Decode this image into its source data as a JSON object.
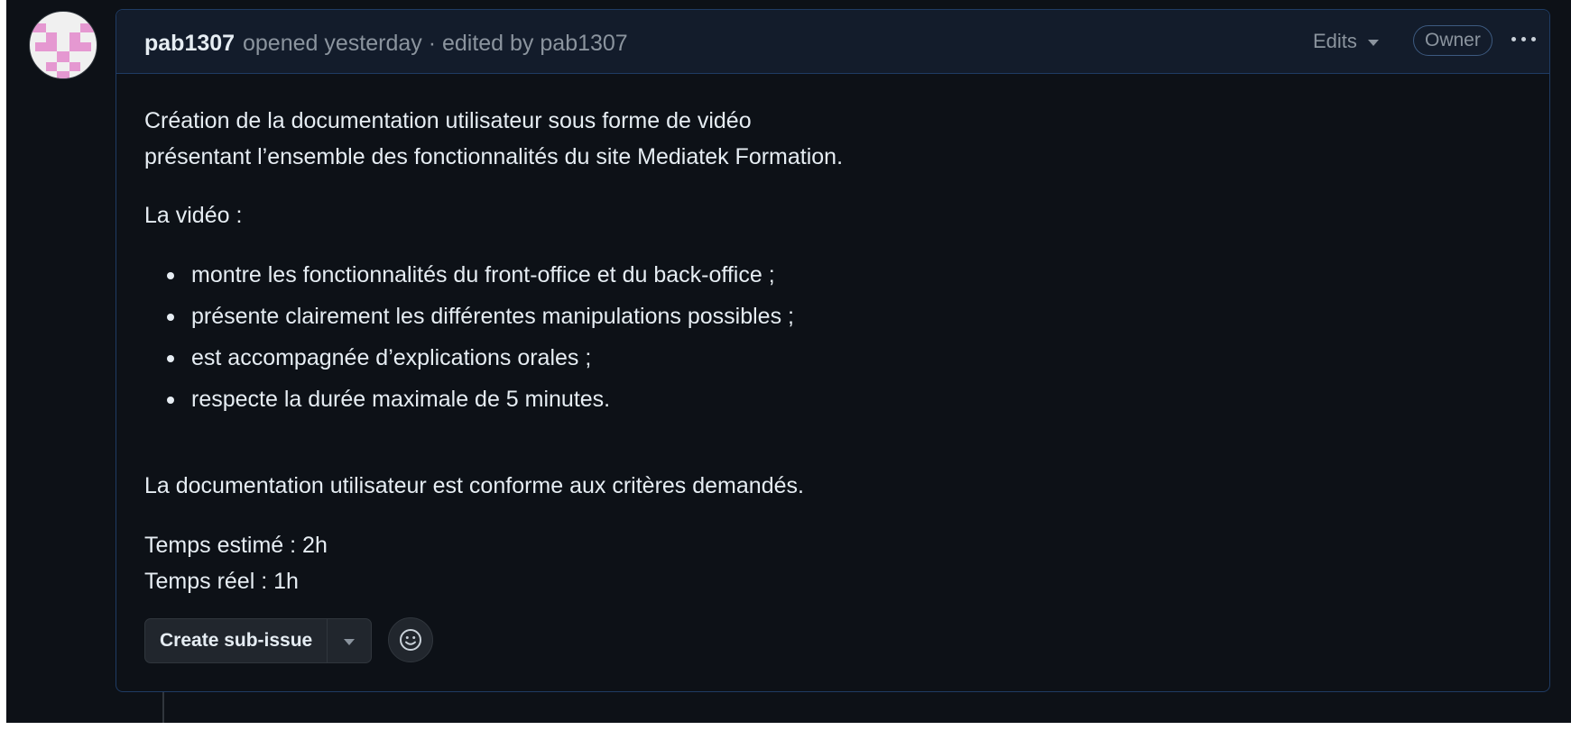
{
  "issue": {
    "author": "pab1307",
    "meta": "opened yesterday · edited by pab1307",
    "edits_label": "Edits",
    "owner_badge": "Owner",
    "more_icon": "kebab-horizontal-icon"
  },
  "description": {
    "paragraph1_line1": "Création de la documentation utilisateur sous forme de vidéo",
    "paragraph1_line2": "présentant l’ensemble des fonctionnalités du site Mediatek Formation.",
    "paragraph2": "La vidéo :",
    "list": [
      "montre les fonctionnalités du front-office et du back-office ;",
      "présente clairement les différentes manipulations possibles ;",
      "est accompagnée d’explications orales ;",
      "respecte la durée maximale de 5 minutes."
    ],
    "paragraph3": "La documentation utilisateur est conforme aux critères demandés.",
    "estimate_line": "Temps estimé : 2h",
    "actual_line": "Temps réel : 1h"
  },
  "actions": {
    "create_sub_issue": "Create sub-issue",
    "dropdown_icon": "triangle-down-icon",
    "reaction_icon": "smiley-icon"
  },
  "colors": {
    "background": "#0d1117",
    "header_bg": "#131c2b",
    "border": "#1f3b63",
    "text": "#e6edf3",
    "muted": "#8b949e",
    "avatar_pink": "#e598d1"
  }
}
